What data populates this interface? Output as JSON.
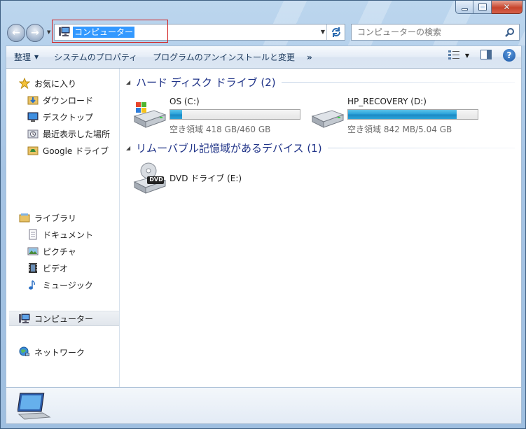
{
  "window": {
    "caption": {
      "minimize_glyph": "",
      "maximize_glyph": "",
      "close_glyph": "✕"
    }
  },
  "nav": {
    "back_glyph": "←",
    "forward_glyph": "→",
    "address": "コンピューター",
    "search_placeholder": "コンピューターの検索"
  },
  "toolbar": {
    "organize": "整理",
    "system_properties": "システムのプロパティ",
    "uninstall": "プログラムのアンインストールと変更",
    "more": "»",
    "help": "?"
  },
  "sidebar": {
    "favorites": {
      "header": "お気に入り",
      "items": [
        {
          "label": "ダウンロード",
          "icon": "download-folder-icon"
        },
        {
          "label": "デスクトップ",
          "icon": "desktop-icon"
        },
        {
          "label": "最近表示した場所",
          "icon": "recent-places-icon"
        },
        {
          "label": "Google ドライブ",
          "icon": "google-drive-folder-icon"
        }
      ]
    },
    "libraries": {
      "header": "ライブラリ",
      "items": [
        {
          "label": "ドキュメント",
          "icon": "documents-icon"
        },
        {
          "label": "ピクチャ",
          "icon": "pictures-icon"
        },
        {
          "label": "ビデオ",
          "icon": "videos-icon"
        },
        {
          "label": "ミュージック",
          "icon": "music-icon"
        }
      ]
    },
    "computer": "コンピューター",
    "network": "ネットワーク"
  },
  "main": {
    "hard_disks": {
      "header": "ハード ディスク ドライブ (2)",
      "drives": [
        {
          "name": "OS (C:)",
          "free": "空き領域 418 GB/460 GB",
          "used_fraction": 0.09
        },
        {
          "name": "HP_RECOVERY (D:)",
          "free": "空き領域 842 MB/5.04 GB",
          "used_fraction": 0.84
        }
      ]
    },
    "removable": {
      "header": "リムーバブル記憶域があるデバイス (1)",
      "drives": [
        {
          "name": "DVD ドライブ (E:)",
          "badge": "DVD"
        }
      ]
    }
  },
  "colors": {
    "selection": "#3399ff",
    "progress": "#26a0da",
    "group_header": "#1e3287",
    "highlight_box": "#d22020"
  }
}
